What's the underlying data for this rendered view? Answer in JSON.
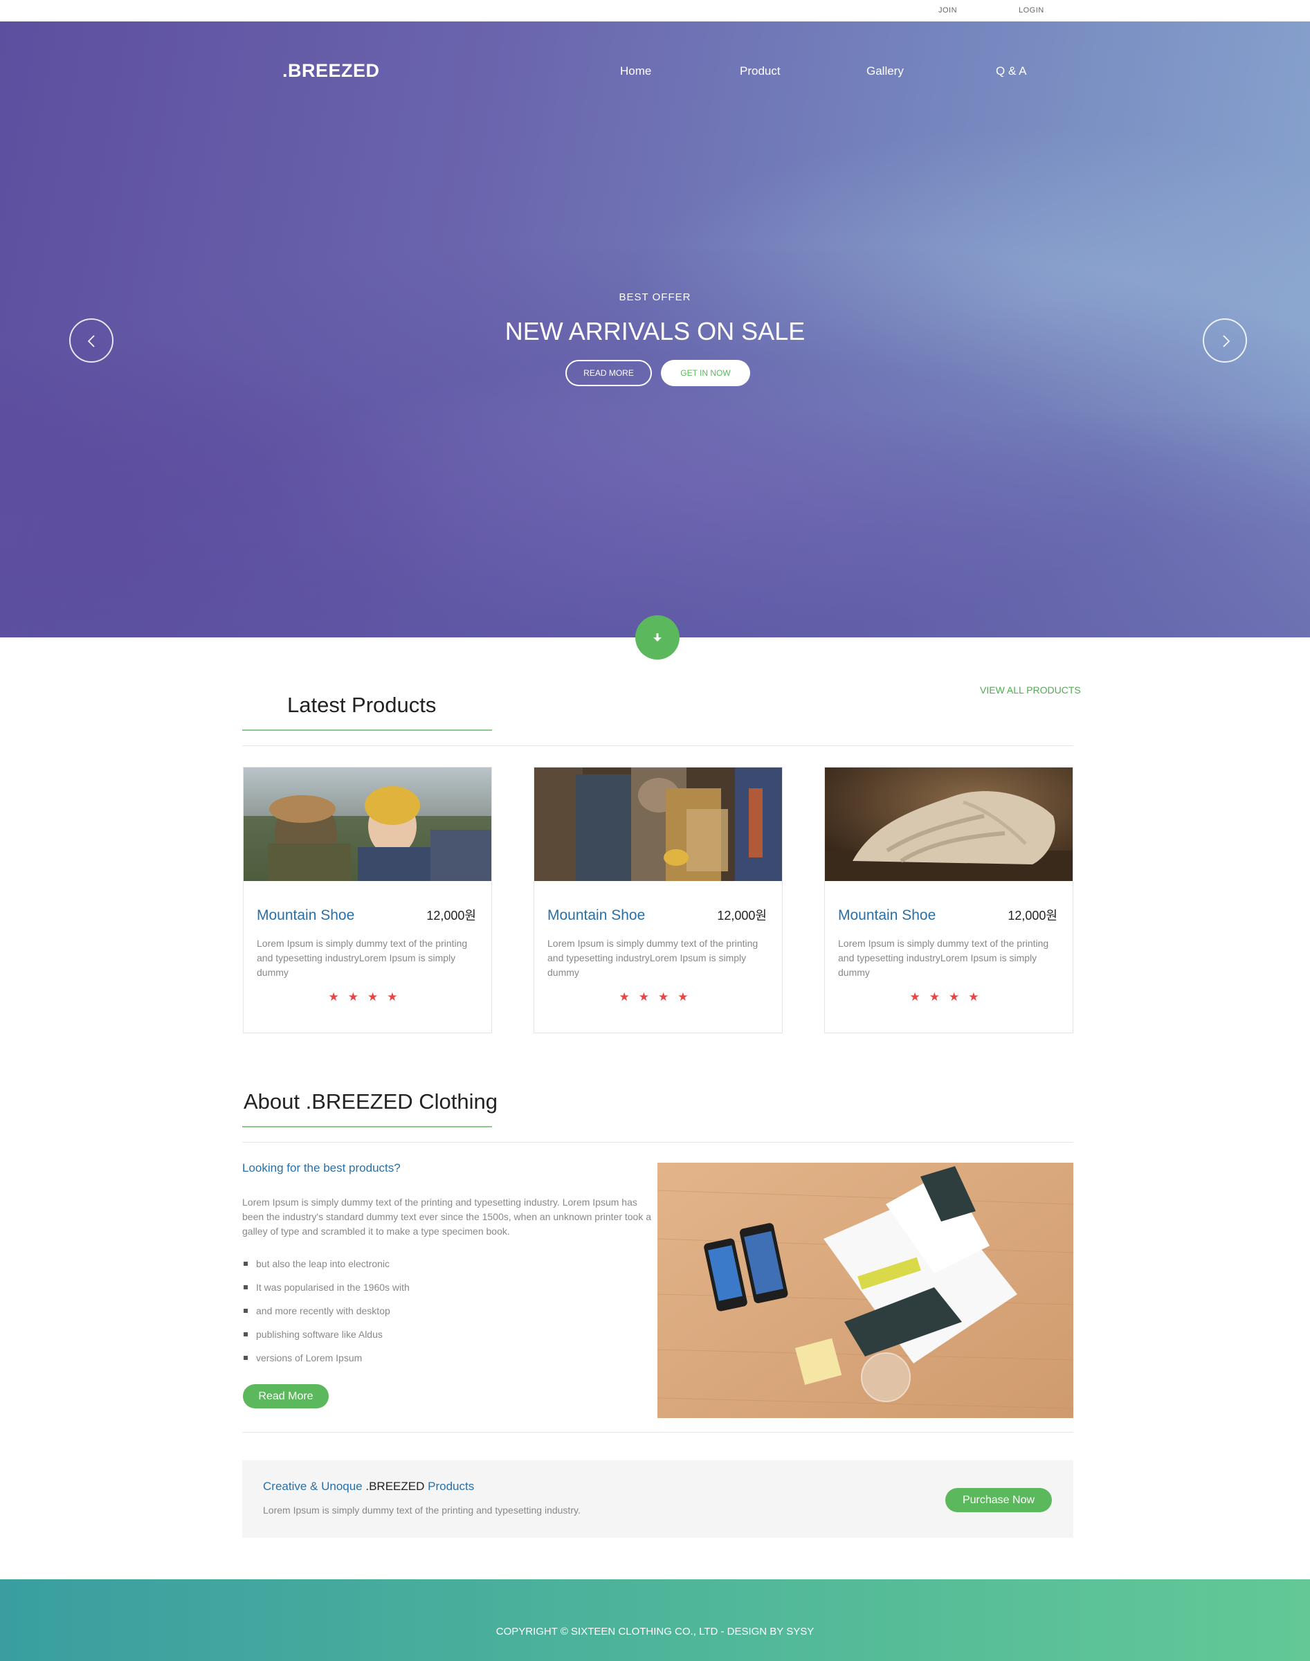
{
  "topbar": {
    "join": "JOIN",
    "login": "LOGIN"
  },
  "header": {
    "logo": ".BREEZED",
    "nav": [
      "Home",
      "Product",
      "Gallery",
      "Q & A"
    ]
  },
  "hero": {
    "kicker": "BEST OFFER",
    "title": "NEW ARRIVALS ON SALE",
    "read_more": "READ MORE",
    "get_in_now": "GET IN NOW"
  },
  "latest": {
    "title": "Latest Products",
    "view_all": "VIEW ALL PRODUCTS",
    "products": [
      {
        "name": "Mountain Shoe",
        "price": "12,000원",
        "desc": "Lorem Ipsum is simply dummy text of the printing and typesetting industryLorem Ipsum is simply dummy",
        "rating": 4
      },
      {
        "name": "Mountain Shoe",
        "price": "12,000원",
        "desc": "Lorem Ipsum is simply dummy text of the printing and typesetting industryLorem Ipsum is simply dummy",
        "rating": 4
      },
      {
        "name": "Mountain Shoe",
        "price": "12,000원",
        "desc": "Lorem Ipsum is simply dummy text of the printing and typesetting industryLorem Ipsum is simply dummy",
        "rating": 4
      }
    ]
  },
  "about": {
    "title": "About .BREEZED Clothing",
    "question": "Looking for the best products?",
    "paragraph": "Lorem Ipsum is simply dummy text of the printing and typesetting industry. Lorem Ipsum has been the industry's standard dummy text ever since the 1500s, when an unknown printer took a galley of type and scrambled it to make a type specimen book.",
    "list": [
      "but also the leap into electronic",
      "It was popularised in the 1960s with",
      "and more recently with desktop",
      "publishing software like Aldus",
      "versions of Lorem Ipsum"
    ],
    "read_more": "Read More"
  },
  "cta": {
    "title_prefix": "Creative & Unoque",
    "title_brand": ".BREEZED",
    "title_suffix": "Products",
    "subtitle": "Lorem Ipsum is simply dummy text of the printing and typesetting industry.",
    "button": "Purchase Now"
  },
  "footer": {
    "copyright": "COPYRIGHT © SIXTEEN CLOTHING CO., LTD - DESIGN BY SYSY"
  },
  "colors": {
    "accent_green": "#5cb85c",
    "link_blue": "#2a6fa6",
    "star_red": "#e84545"
  }
}
